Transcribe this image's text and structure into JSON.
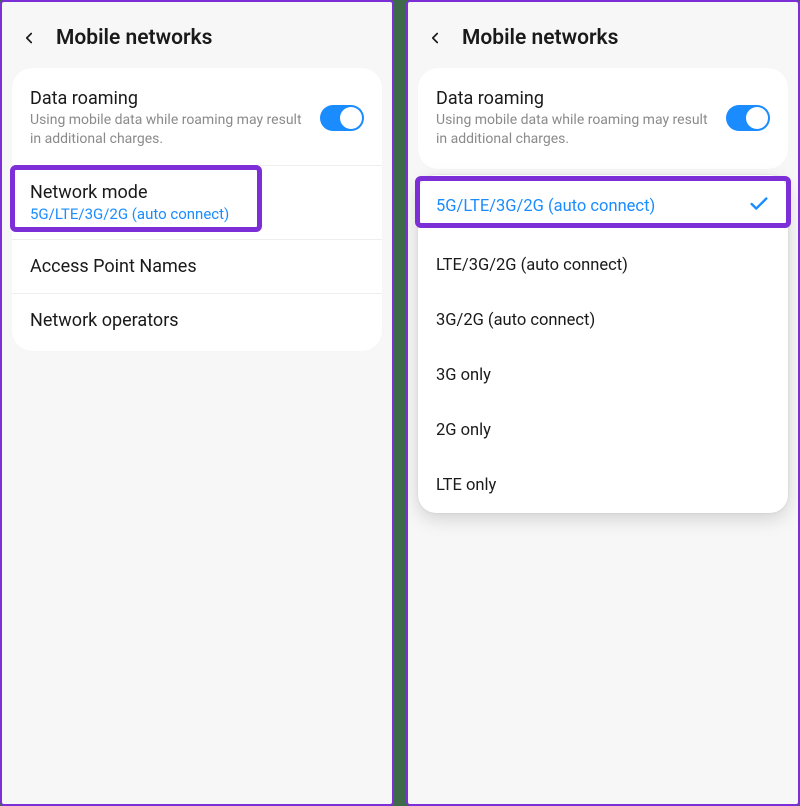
{
  "page_title": "Mobile networks",
  "roaming": {
    "title": "Data roaming",
    "subtitle": "Using mobile data while roaming may result in additional charges.",
    "enabled": true
  },
  "network_mode": {
    "title": "Network mode",
    "current": "5G/LTE/3G/2G (auto connect)"
  },
  "apn_label": "Access Point Names",
  "operators_label": "Network operators",
  "dropdown": {
    "options": [
      "5G/LTE/3G/2G (auto connect)",
      "LTE/3G/2G (auto connect)",
      "3G/2G (auto connect)",
      "3G only",
      "2G only",
      "LTE only"
    ],
    "selected_index": 0
  }
}
